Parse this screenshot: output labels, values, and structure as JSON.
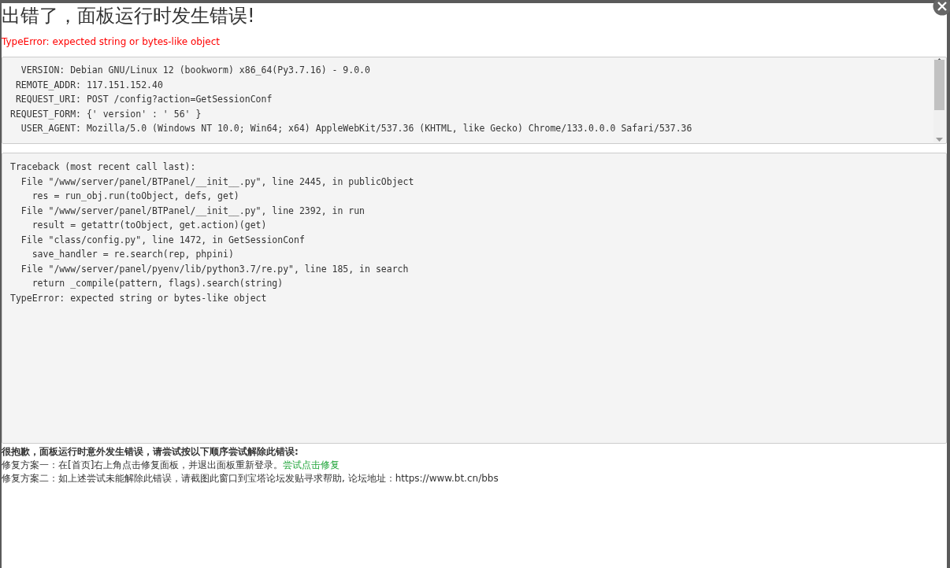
{
  "dialog": {
    "title": "出错了，面板运行时发生错误!",
    "error_message": "TypeError: expected string or bytes-like object"
  },
  "request_info": [
    {
      "key": "  VERSION:",
      "value": "Debian GNU/Linux 12 (bookworm) x86_64(Py3.7.16) - 9.0.0"
    },
    {
      "key": " REMOTE_ADDR:",
      "value": "117.151.152.40"
    },
    {
      "key": " REQUEST_URI:",
      "value": "POST /config?action=GetSessionConf"
    },
    {
      "key": "REQUEST_FORM:",
      "value": "{' version' : ' 56' }"
    },
    {
      "key": "  USER_AGENT:",
      "value": "Mozilla/5.0 (Windows NT 10.0; Win64; x64) AppleWebKit/537.36 (KHTML, like Gecko) Chrome/133.0.0.0 Safari/537.36"
    }
  ],
  "traceback": [
    "Traceback (most recent call last):",
    "  File \"/www/server/panel/BTPanel/__init__.py\", line 2445, in publicObject",
    "    res = run_obj.run(toObject, defs, get)",
    "  File \"/www/server/panel/BTPanel/__init__.py\", line 2392, in run",
    "    result = getattr(toObject, get.action)(get)",
    "  File \"class/config.py\", line 1472, in GetSessionConf",
    "    save_handler = re.search(rep, phpini)",
    "  File \"/www/server/panel/pyenv/lib/python3.7/re.py\", line 185, in search",
    "    return _compile(pattern, flags).search(string)",
    "TypeError: expected string or bytes-like object"
  ],
  "help": {
    "heading": "很抱歉，面板运行时意外发生错误，请尝试按以下顺序尝试解除此错误:",
    "steps": [
      {
        "text": "修复方案一：在[首页]右上角点击修复面板，并退出面板重新登录。",
        "link": "尝试点击修复"
      },
      {
        "text": "修复方案二：如上述尝试未能解除此错误，请截图此窗口到宝塔论坛发贴寻求帮助, 论坛地址：https://www.bt.cn/bbs"
      }
    ]
  }
}
